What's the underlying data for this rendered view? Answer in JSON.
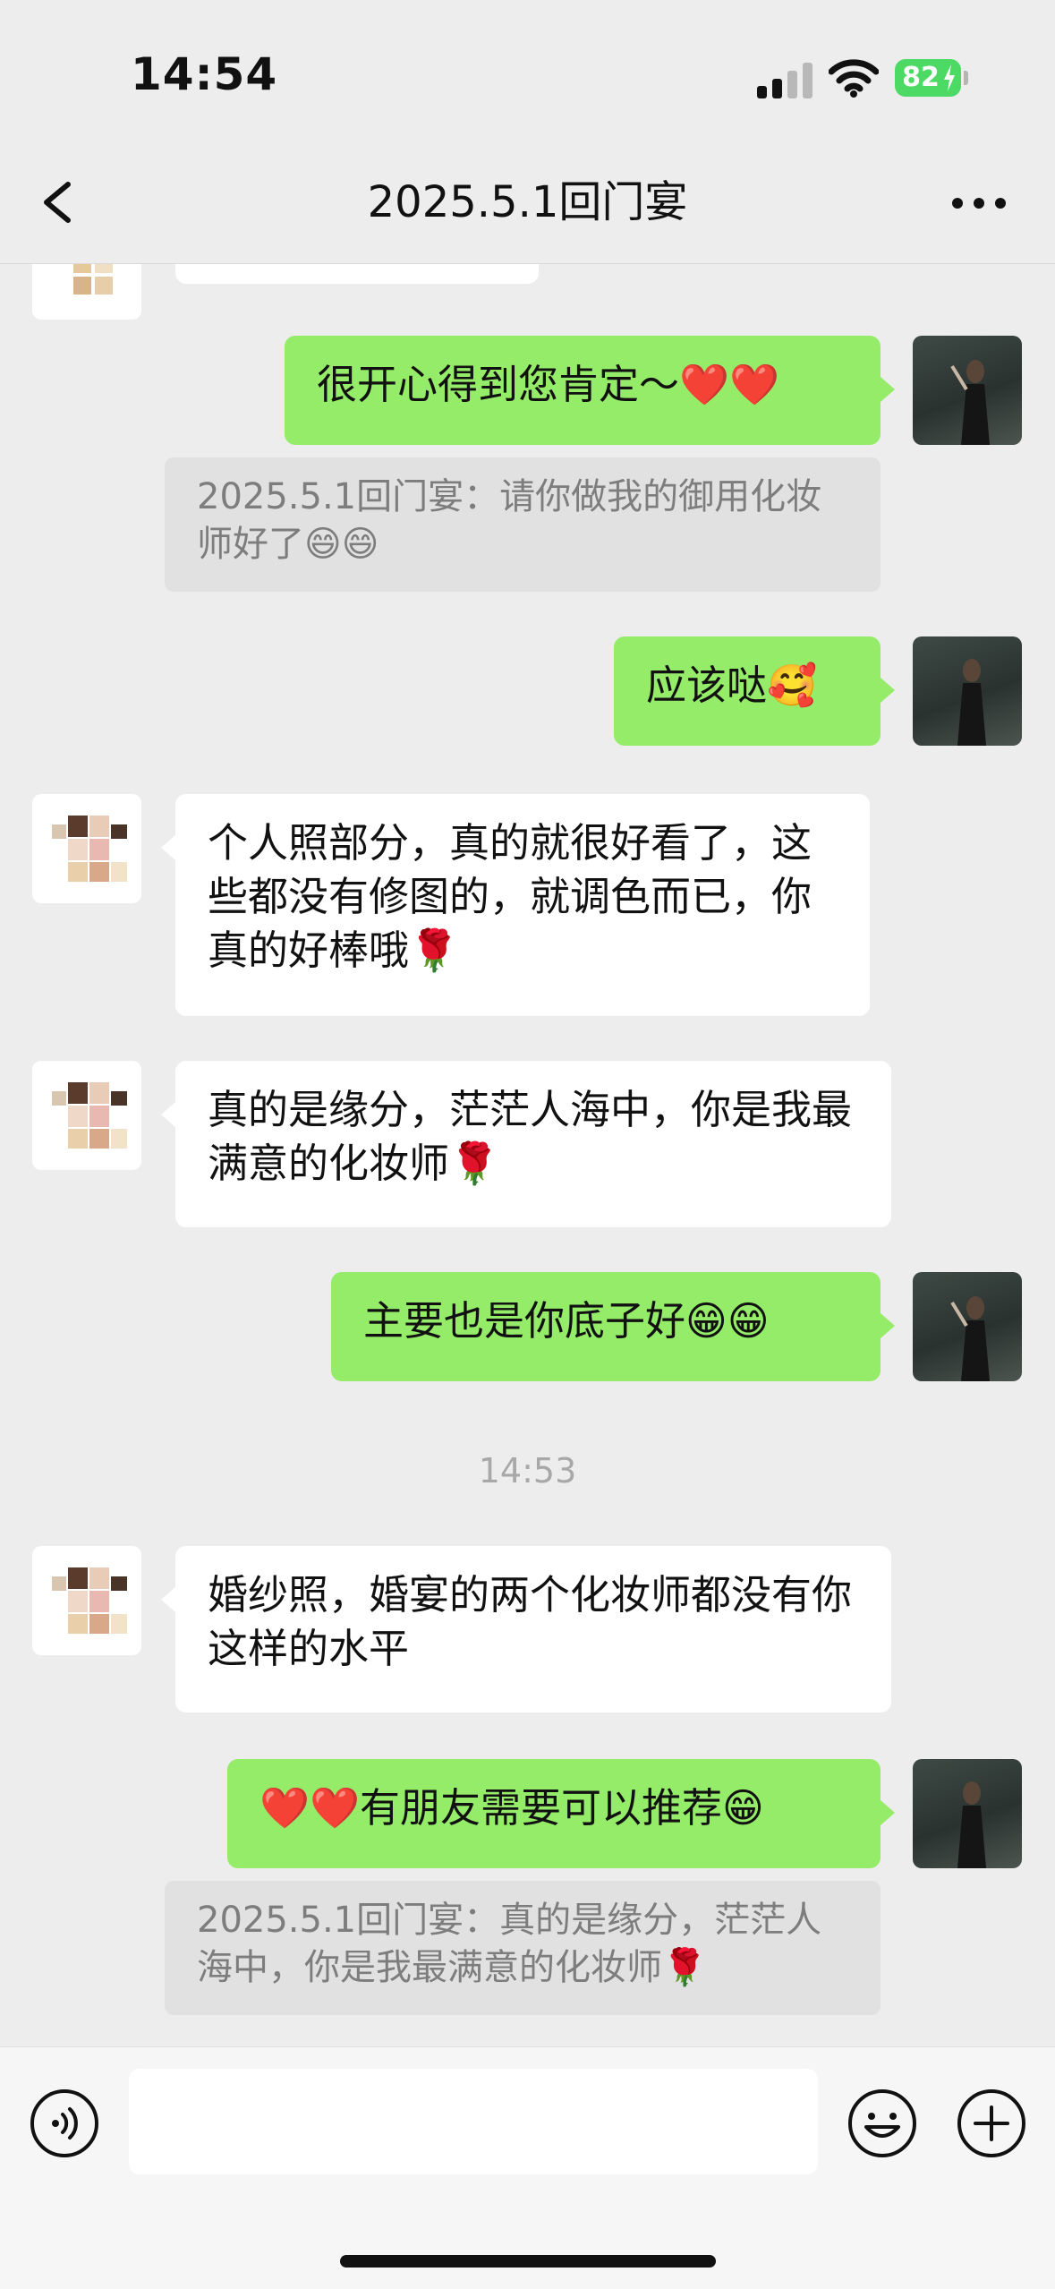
{
  "status_bar": {
    "time": "14:54",
    "battery": "82"
  },
  "header": {
    "title": "2025.5.1回门宴"
  },
  "messages": [
    {
      "side": "me",
      "text": "很开心得到您肯定～❤️❤️"
    },
    {
      "quote": "2025.5.1回门宴：请你做我的御用化妆师好了😄😄"
    },
    {
      "side": "me",
      "text": "应该哒🥰"
    },
    {
      "side": "other",
      "text": "个人照部分，真的就很好看了，这些都没有修图的，就调色而已，你真的好棒哦🌹"
    },
    {
      "side": "other",
      "text": "真的是缘分，茫茫人海中，你是我最满意的化妆师🌹"
    },
    {
      "side": "me",
      "text": "主要也是你底子好😁😁"
    },
    {
      "timestamp": "14:53"
    },
    {
      "side": "other",
      "text": "婚纱照，婚宴的两个化妆师都没有你这样的水平"
    },
    {
      "side": "me",
      "text": "❤️❤️有朋友需要可以推荐😁"
    },
    {
      "quote": "2025.5.1回门宴：真的是缘分，茫茫人海中，你是我最满意的化妆师🌹"
    }
  ],
  "colors": {
    "my_bubble": "#95ec69",
    "other_bubble": "#ffffff",
    "background": "#ededed"
  },
  "icons": {
    "back": "chevron-left-icon",
    "more": "more-dots-icon",
    "voice": "voice-icon",
    "emoji": "emoji-icon",
    "plus": "plus-icon"
  }
}
